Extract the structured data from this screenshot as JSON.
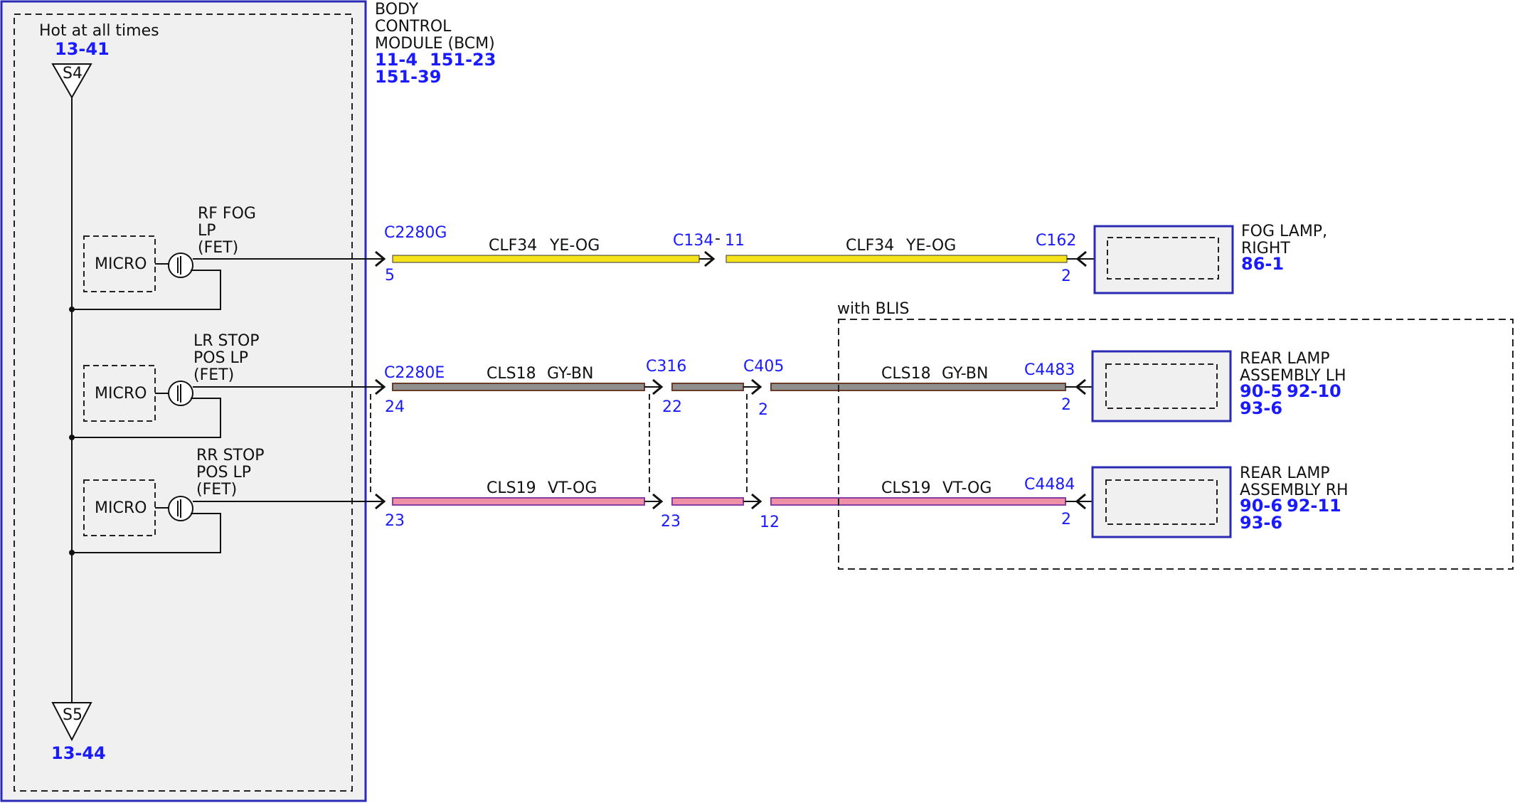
{
  "colors": {
    "ref_text": "#1a1aff",
    "module_border": "#2a2ab5",
    "module_fill": "#f0f0f0",
    "wire_yellow": "#f5e21a",
    "wire_gray": "#8f8f8f",
    "wire_pink": "#ef8fa8"
  },
  "bcm": {
    "label_line1": "BODY",
    "label_line2": "CONTROL",
    "label_line3": "MODULE (BCM)",
    "ref1": "11-4",
    "ref2": "151-23",
    "ref3": "151-39"
  },
  "power": {
    "hot_label": "Hot at all times",
    "top_ref": "13-41",
    "top_splice": "S4",
    "bottom_splice": "S5",
    "bottom_ref": "13-44"
  },
  "circuits": [
    {
      "micro": "MICRO",
      "fet_line1": "RF FOG",
      "fet_line2": "LP",
      "fet_line3": "(FET)",
      "conn_bcm": "C2280G",
      "pin_bcm": "5",
      "wire1": "CLF34",
      "color1": "YE-OG",
      "inline_conn": "C134",
      "inline_pin": "11",
      "wire2": "CLF34",
      "color2": "YE-OG",
      "conn_comp": "C162",
      "pin_comp": "2",
      "comp_line1": "FOG LAMP,",
      "comp_line2": "RIGHT",
      "comp_ref1": "86-1"
    },
    {
      "micro": "MICRO",
      "fet_line1": "LR STOP",
      "fet_line2": "POS LP",
      "fet_line3": "(FET)",
      "conn_bcm": "C2280E",
      "pin_bcm": "24",
      "inline1_conn": "C316",
      "inline1_pin": "22",
      "inline2_conn": "C405",
      "inline2_pin": "2",
      "wire1": "CLS18",
      "color1": "GY-BN",
      "wire2": "CLS18",
      "color2": "GY-BN",
      "conn_comp": "C4483",
      "pin_comp": "2",
      "comp_line1": "REAR LAMP",
      "comp_line2": "ASSEMBLY LH",
      "comp_ref1": "90-5",
      "comp_ref2": "92-10",
      "comp_ref3": "93-6"
    },
    {
      "micro": "MICRO",
      "fet_line1": "RR STOP",
      "fet_line2": "POS LP",
      "fet_line3": "(FET)",
      "pin_bcm": "23",
      "inline1_pin": "23",
      "inline2_pin": "12",
      "wire1": "CLS19",
      "color1": "VT-OG",
      "wire2": "CLS19",
      "color2": "VT-OG",
      "conn_comp": "C4484",
      "pin_comp": "2",
      "comp_line1": "REAR LAMP",
      "comp_line2": "ASSEMBLY RH",
      "comp_ref1": "90-6",
      "comp_ref2": "92-11",
      "comp_ref3": "93-6"
    }
  ],
  "blis": {
    "label": "with BLIS"
  }
}
